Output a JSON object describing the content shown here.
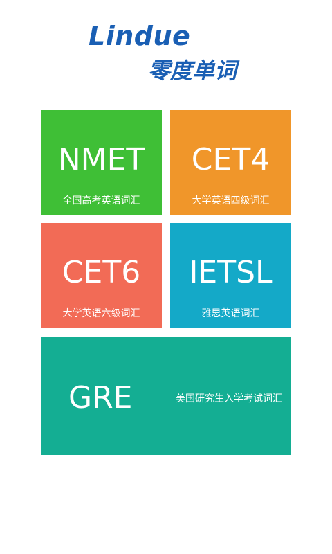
{
  "header": {
    "logo_en": "Lindue",
    "logo_cn": "零度单词"
  },
  "tiles": [
    {
      "title": "NMET",
      "subtitle": "全国高考英语词汇",
      "color": "#3fbf36"
    },
    {
      "title": "CET4",
      "subtitle": "大学英语四级词汇",
      "color": "#f0962a"
    },
    {
      "title": "CET6",
      "subtitle": "大学英语六级词汇",
      "color": "#f26b56"
    },
    {
      "title": "IETSL",
      "subtitle": "雅思英语词汇",
      "color": "#14a9c8"
    },
    {
      "title": "GRE",
      "subtitle": "美国研究生入学考试词汇",
      "color": "#14ae93"
    }
  ],
  "theme": {
    "logo_color": "#1a5fb4",
    "background": "#ffffff"
  }
}
